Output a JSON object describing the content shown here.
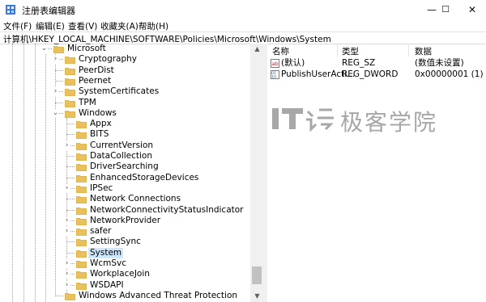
{
  "window": {
    "title": "注册表编辑器",
    "minimize": "—",
    "maximize": "☐",
    "close": "✕"
  },
  "menu": {
    "items": [
      "文件(F)",
      "编辑(E)",
      "查看(V)",
      "收藏夹(A)",
      "帮助(H)"
    ]
  },
  "address": {
    "path": "计算机\\HKEY_LOCAL_MACHINE\\SOFTWARE\\Policies\\Microsoft\\Windows\\System"
  },
  "tree": {
    "nodes": [
      {
        "label": "Microsoft",
        "expanded": true,
        "selected": false
      },
      {
        "label": "Cryptography",
        "expanded": false,
        "selected": false
      },
      {
        "label": "PeerDist",
        "expanded": false,
        "selected": false
      },
      {
        "label": "Peernet",
        "expanded": false,
        "selected": false
      },
      {
        "label": "SystemCertificates",
        "expanded": false,
        "selected": false
      },
      {
        "label": "TPM",
        "expanded": false,
        "selected": false
      },
      {
        "label": "Windows",
        "expanded": true,
        "selected": false
      },
      {
        "label": "Appx",
        "expanded": false,
        "selected": false
      },
      {
        "label": "BITS",
        "expanded": false,
        "selected": false
      },
      {
        "label": "CurrentVersion",
        "expanded": false,
        "selected": false
      },
      {
        "label": "DataCollection",
        "expanded": false,
        "selected": false
      },
      {
        "label": "DriverSearching",
        "expanded": false,
        "selected": false
      },
      {
        "label": "EnhancedStorageDevices",
        "expanded": false,
        "selected": false
      },
      {
        "label": "IPSec",
        "expanded": false,
        "selected": false
      },
      {
        "label": "Network Connections",
        "expanded": false,
        "selected": false
      },
      {
        "label": "NetworkConnectivityStatusIndicator",
        "expanded": false,
        "selected": false
      },
      {
        "label": "NetworkProvider",
        "expanded": false,
        "selected": false
      },
      {
        "label": "safer",
        "expanded": false,
        "selected": false
      },
      {
        "label": "SettingSync",
        "expanded": false,
        "selected": false
      },
      {
        "label": "System",
        "expanded": false,
        "selected": true
      },
      {
        "label": "WcmSvc",
        "expanded": false,
        "selected": false
      },
      {
        "label": "WorkplaceJoin",
        "expanded": false,
        "selected": false
      },
      {
        "label": "WSDAPI",
        "expanded": false,
        "selected": false
      },
      {
        "label": "Windows Advanced Threat Protection",
        "expanded": false,
        "selected": false
      }
    ]
  },
  "values": {
    "columns": {
      "name": "名称",
      "type": "类型",
      "data": "数据"
    },
    "rows": [
      {
        "icon": "string-value-icon",
        "name": "(默认)",
        "type": "REG_SZ",
        "data": "(数值未设置)"
      },
      {
        "icon": "binary-value-icon",
        "name": "PublishUserActi...",
        "type": "REG_DWORD",
        "data": "0x00000001 (1)"
      }
    ]
  },
  "watermark": {
    "text": "极客学院"
  },
  "colors": {
    "selection": "#cce8ff",
    "folder": "#e8c15e",
    "folder_dark": "#d9a934",
    "watermark": "#a7a7a7"
  }
}
